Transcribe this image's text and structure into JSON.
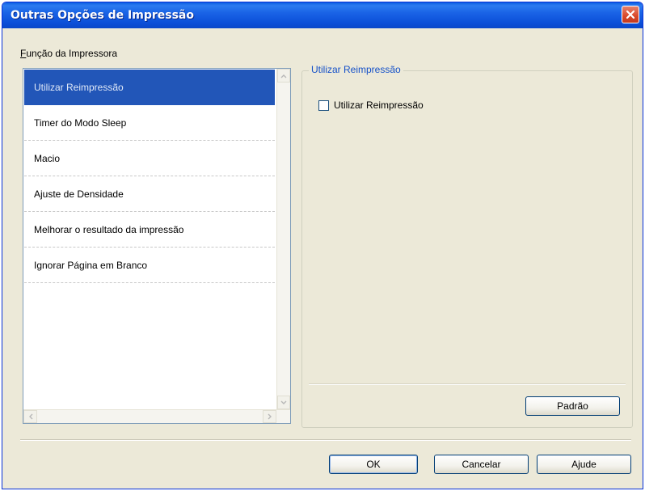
{
  "window": {
    "title": "Outras Opções de Impressão"
  },
  "function_group": {
    "label_prefix": "F",
    "label_rest": "unção da Impressora",
    "items": [
      {
        "label": "Utilizar Reimpressão",
        "selected": true
      },
      {
        "label": "Timer do Modo Sleep",
        "selected": false
      },
      {
        "label": "Macio",
        "selected": false
      },
      {
        "label": "Ajuste de Densidade",
        "selected": false
      },
      {
        "label": "Melhorar o resultado da impressão",
        "selected": false
      },
      {
        "label": "Ignorar Página em Branco",
        "selected": false
      }
    ]
  },
  "settings_panel": {
    "legend": "Utilizar Reimpressão",
    "checkbox_label": "Utilizar Reimpressão",
    "checkbox_checked": false,
    "default_button": "Padrão"
  },
  "footer": {
    "ok": "OK",
    "cancel": "Cancelar",
    "help": "Ajude"
  },
  "colors": {
    "title_bar": "#0a5ee3",
    "selection": "#2256b8",
    "close_button": "#d9482a",
    "legend_text": "#1450c8"
  },
  "icons": [
    "close-icon",
    "scroll-up-icon",
    "scroll-down-icon",
    "scroll-left-icon",
    "scroll-right-icon"
  ]
}
